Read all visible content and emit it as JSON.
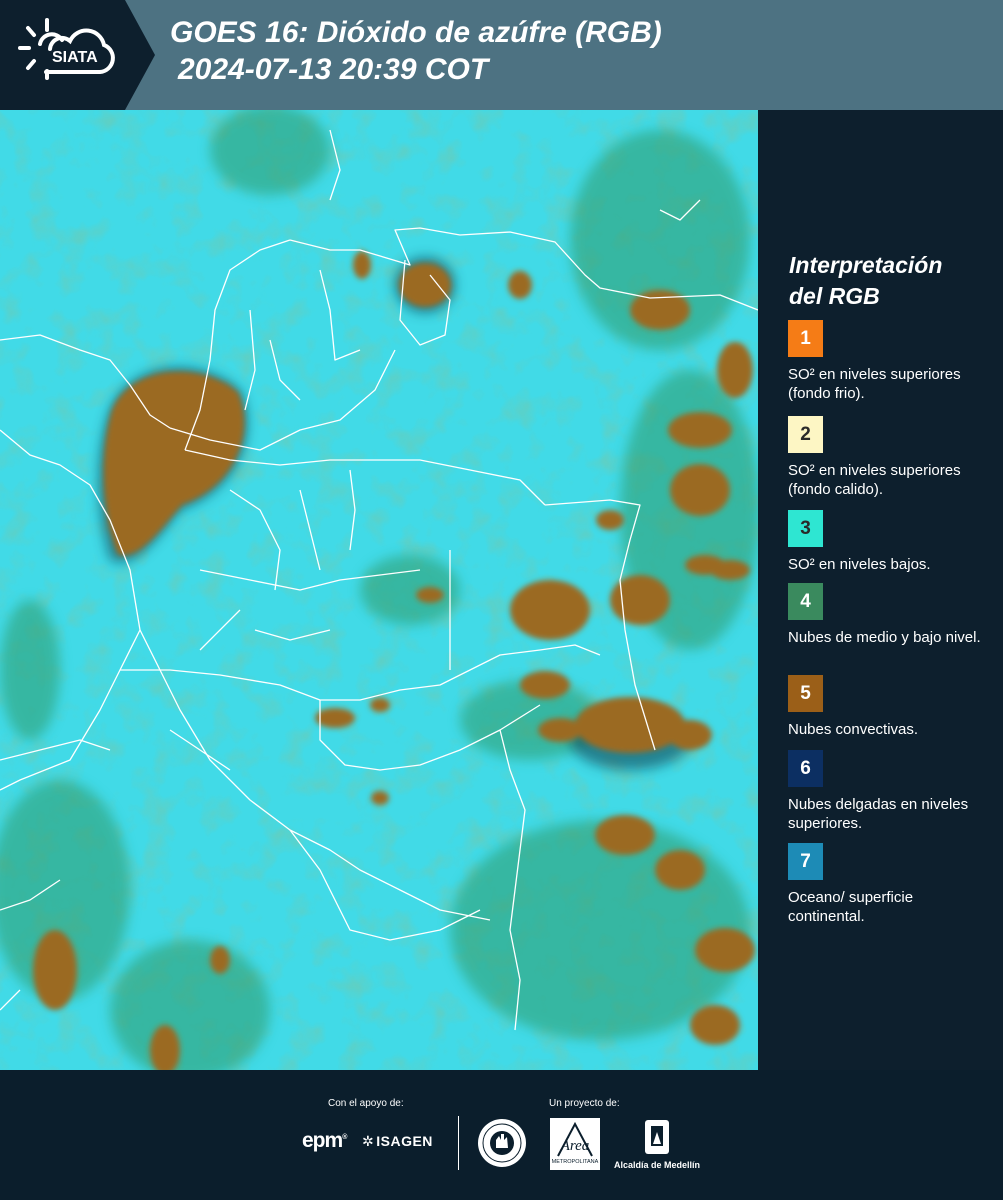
{
  "header": {
    "title": "GOES 16: Dióxido de azúfre (RGB)",
    "timestamp": "2024-07-13 20:39 COT",
    "logo_text": "SIATA"
  },
  "legend": {
    "title_line1": "Interpretación",
    "title_line2": "del RGB",
    "items": [
      {
        "number": "1",
        "color": "#f57c16",
        "text": "SO² en niveles superiores (fondo frio)."
      },
      {
        "number": "2",
        "color": "#fdf6c4",
        "text": "SO² en niveles superiores (fondo calido)."
      },
      {
        "number": "3",
        "color": "#2ee6d2",
        "text": "SO² en niveles bajos."
      },
      {
        "number": "4",
        "color": "#3a8a5e",
        "text": "Nubes de medio y bajo nivel."
      },
      {
        "number": "5",
        "color": "#9b5f18",
        "text": "Nubes convectivas."
      },
      {
        "number": "6",
        "color": "#0c2f62",
        "text": "Nubes delgadas en niveles superiores."
      },
      {
        "number": "7",
        "color": "#1d8bb6",
        "text": "Oceano/ superficie continental."
      }
    ]
  },
  "footer": {
    "support_label": "Con el apoyo de:",
    "project_label": "Un proyecto de:",
    "epm": "epm",
    "isagen": "ISAGEN",
    "area_metropolitana": "Área",
    "area_subtitle": "METROPOLITANA",
    "medellin": "Alcaldía de Medellín"
  },
  "colors": {
    "ocean": "#2cd6e4",
    "convective": "#9b6a24",
    "mid_clouds": "#2f9b6a",
    "header_bg": "#4d7282",
    "panel_bg": "#0d1f2d"
  }
}
